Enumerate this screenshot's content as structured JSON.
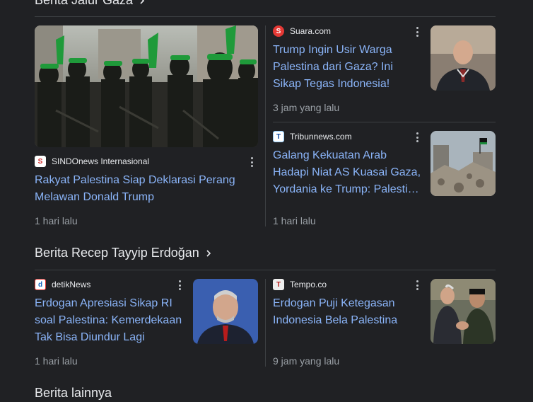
{
  "sections": {
    "gaza": {
      "title": "Berita Jalur Gaza"
    },
    "erdogan": {
      "title": "Berita Recep Tayyip Erdoğan"
    },
    "other": {
      "title": "Berita lainnya"
    }
  },
  "gaza_cards": [
    {
      "source": "SINDOnews Internasional",
      "title": "Rakyat Palestina Siap Deklarasi Perang Melawan Donald Trump",
      "time": "1 hari lalu"
    },
    {
      "source": "Suara.com",
      "title": "Trump Ingin Usir Warga Palestina dari Gaza? Ini Sikap Tegas Indonesia!",
      "time": "3 jam yang lalu"
    },
    {
      "source": "Tribunnews.com",
      "title": "Galang Kekuatan Arab Hadapi Niat AS Kuasai Gaza, Yordania ke Trump: Palesti…",
      "time": "1 hari lalu"
    }
  ],
  "erdogan_cards": [
    {
      "source": "detikNews",
      "title": "Erdogan Apresiasi Sikap RI soal Palestina: Kemerdekaan Tak Bisa Diundur Lagi",
      "time": "1 hari lalu"
    },
    {
      "source": "Tempo.co",
      "title": "Erdogan Puji Ketegasan Indonesia Bela Palestina",
      "time": "9 jam yang lalu"
    }
  ],
  "favicons": {
    "sindonews": "S",
    "suara": "S",
    "tribun": "T",
    "detik": "d",
    "tempo": "T"
  },
  "colors": {
    "link": "#8ab4f8",
    "background": "#202124",
    "muted": "#9aa0a6"
  }
}
